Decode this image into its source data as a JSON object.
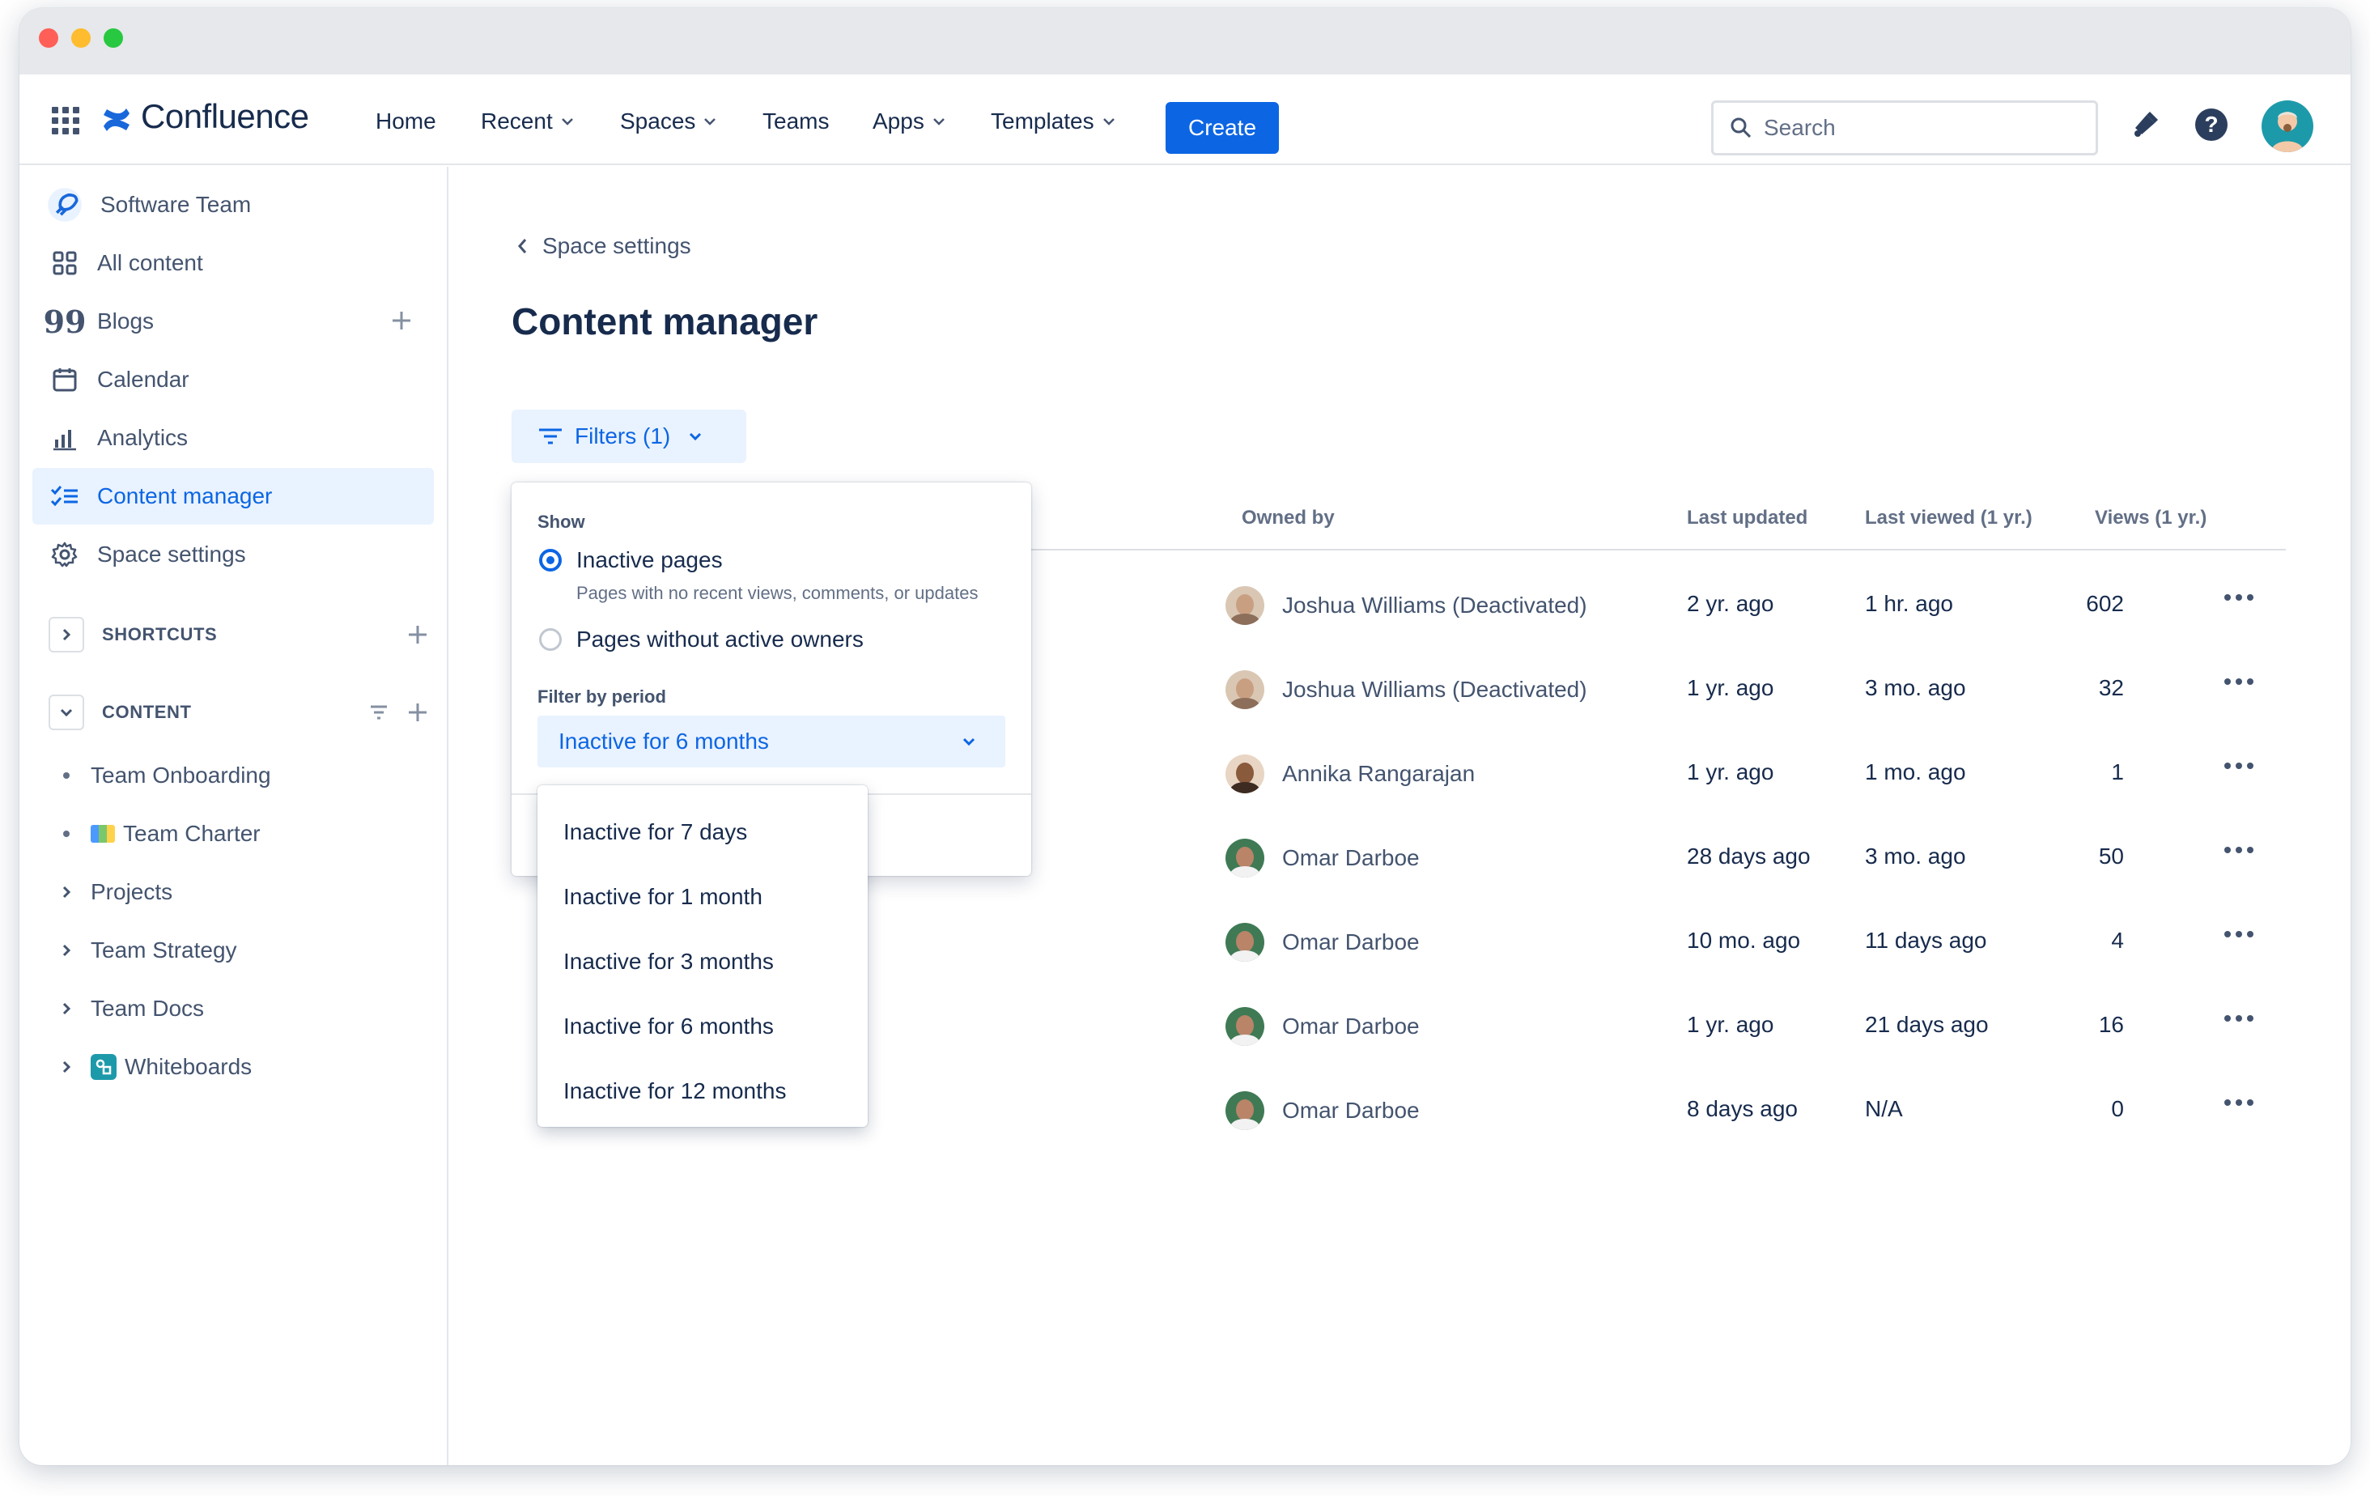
{
  "topnav": {
    "app_name": "Confluence",
    "items": [
      {
        "label": "Home",
        "has_dropdown": false
      },
      {
        "label": "Recent",
        "has_dropdown": true
      },
      {
        "label": "Spaces",
        "has_dropdown": true
      },
      {
        "label": "Teams",
        "has_dropdown": false
      },
      {
        "label": "Apps",
        "has_dropdown": true
      },
      {
        "label": "Templates",
        "has_dropdown": true
      }
    ],
    "create_label": "Create",
    "search_placeholder": "Search",
    "icons": [
      "apps-grid-icon",
      "confluence-logo-icon",
      "search-icon",
      "notification-icon",
      "help-icon",
      "user-avatar"
    ]
  },
  "sidebar": {
    "space_name": "Software Team",
    "items": [
      {
        "label": "All content",
        "icon": "grid-icon"
      },
      {
        "label": "Blogs",
        "icon": "quote-icon"
      },
      {
        "label": "Calendar",
        "icon": "calendar-icon"
      },
      {
        "label": "Analytics",
        "icon": "bar-chart-icon"
      },
      {
        "label": "Content manager",
        "icon": "checklist-icon"
      },
      {
        "label": "Space settings",
        "icon": "gear-icon"
      }
    ],
    "shortcuts_label": "SHORTCUTS",
    "content_label": "CONTENT",
    "tree": [
      {
        "label": "Team Onboarding",
        "kind": "bullet"
      },
      {
        "label": "Team Charter",
        "kind": "bullet",
        "emoji": "map-icon"
      },
      {
        "label": "Projects",
        "kind": "chevron"
      },
      {
        "label": "Team Strategy",
        "kind": "chevron"
      },
      {
        "label": "Team Docs",
        "kind": "chevron"
      },
      {
        "label": "Whiteboards",
        "kind": "chevron",
        "emoji": "whiteboard-icon"
      }
    ]
  },
  "main": {
    "back_label": "Space settings",
    "title": "Content manager",
    "filters_label": "Filters (1)",
    "columns": {
      "owned_by": "Owned by",
      "last_updated": "Last updated",
      "last_viewed": "Last viewed (1 yr.)",
      "views": "Views (1 yr.)"
    },
    "rows": [
      {
        "owner": "Joshua Williams (Deactivated)",
        "last_updated": "2 yr. ago",
        "last_viewed": "1 hr. ago",
        "views": "602",
        "avatar": "joshua"
      },
      {
        "owner": "Joshua Williams (Deactivated)",
        "last_updated": "1 yr. ago",
        "last_viewed": "3 mo. ago",
        "views": "32",
        "avatar": "joshua"
      },
      {
        "owner": "Annika Rangarajan",
        "last_updated": "1 yr. ago",
        "last_viewed": "1 mo. ago",
        "views": "1",
        "avatar": "annika"
      },
      {
        "owner": "Omar Darboe",
        "last_updated": "28 days ago",
        "last_viewed": "3 mo. ago",
        "views": "50",
        "avatar": "omar"
      },
      {
        "owner": "Omar Darboe",
        "last_updated": "10 mo. ago",
        "last_viewed": "11 days ago",
        "views": "4",
        "avatar": "omar"
      },
      {
        "owner": "Omar Darboe",
        "last_updated": "1 yr. ago",
        "last_viewed": "21 days ago",
        "views": "16",
        "avatar": "omar"
      },
      {
        "owner": "Omar Darboe",
        "last_updated": "8 days ago",
        "last_viewed": "N/A",
        "views": "0",
        "avatar": "omar"
      }
    ]
  },
  "filter_popup": {
    "show_label": "Show",
    "options": [
      {
        "label": "Inactive pages",
        "description": "Pages with no recent views, comments, or updates",
        "selected": true
      },
      {
        "label": "Pages without active owners",
        "description": "",
        "selected": false
      }
    ],
    "period_label": "Filter by period",
    "period_value": "Inactive for 6 months",
    "period_options": [
      "Inactive for 7 days",
      "Inactive for 1 month",
      "Inactive for 3 months",
      "Inactive for 6 months",
      "Inactive for 12 months"
    ]
  },
  "colors": {
    "brand": "#0C66E4",
    "selected_bg": "#E9F2FF",
    "text": "#172B4D",
    "subtle_text": "#44546F"
  }
}
